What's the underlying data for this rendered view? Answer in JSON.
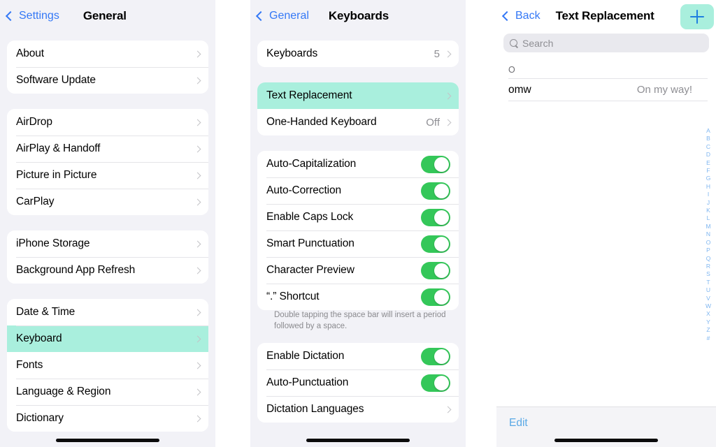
{
  "left_panel": {
    "nav": {
      "back_label": "Settings",
      "title": "General"
    },
    "groups": [
      {
        "rows": [
          {
            "label": "About",
            "accessory": "chevron"
          },
          {
            "label": "Software Update",
            "accessory": "chevron"
          }
        ]
      },
      {
        "rows": [
          {
            "label": "AirDrop",
            "accessory": "chevron"
          },
          {
            "label": "AirPlay & Handoff",
            "accessory": "chevron"
          },
          {
            "label": "Picture in Picture",
            "accessory": "chevron"
          },
          {
            "label": "CarPlay",
            "accessory": "chevron"
          }
        ]
      },
      {
        "rows": [
          {
            "label": "iPhone Storage",
            "accessory": "chevron"
          },
          {
            "label": "Background App Refresh",
            "accessory": "chevron"
          }
        ]
      },
      {
        "rows": [
          {
            "label": "Date & Time",
            "accessory": "chevron"
          },
          {
            "label": "Keyboard",
            "accessory": "chevron",
            "selected": true
          },
          {
            "label": "Fonts",
            "accessory": "chevron"
          },
          {
            "label": "Language & Region",
            "accessory": "chevron"
          },
          {
            "label": "Dictionary",
            "accessory": "chevron"
          }
        ]
      }
    ]
  },
  "mid_panel": {
    "nav": {
      "back_label": "General",
      "title": "Keyboards"
    },
    "group1": [
      {
        "label": "Keyboards",
        "value": "5",
        "accessory": "chevron"
      }
    ],
    "group2": [
      {
        "label": "Text Replacement",
        "accessory": "chevron",
        "selected": true
      },
      {
        "label": "One-Handed Keyboard",
        "value": "Off",
        "accessory": "chevron"
      }
    ],
    "group3": [
      {
        "label": "Auto-Capitalization",
        "toggle": "on"
      },
      {
        "label": "Auto-Correction",
        "toggle": "on"
      },
      {
        "label": "Enable Caps Lock",
        "toggle": "on"
      },
      {
        "label": "Smart Punctuation",
        "toggle": "on"
      },
      {
        "label": "Character Preview",
        "toggle": "on"
      },
      {
        "label": "“.” Shortcut",
        "toggle": "on"
      }
    ],
    "footnote": "Double tapping the space bar will insert a period followed by a space.",
    "group4": [
      {
        "label": "Enable Dictation",
        "toggle": "on"
      },
      {
        "label": "Auto-Punctuation",
        "toggle": "on"
      },
      {
        "label": "Dictation Languages",
        "accessory": "chevron"
      }
    ]
  },
  "right_panel": {
    "nav": {
      "back_label": "Back",
      "title": "Text Replacement",
      "add_icon": "plus-icon"
    },
    "search": {
      "placeholder": "Search",
      "value": "",
      "icon": "search-icon"
    },
    "sections": [
      {
        "header": "O",
        "items": [
          {
            "shortcut": "omw",
            "phrase": "On my way!"
          }
        ]
      }
    ],
    "index_letters": [
      "A",
      "B",
      "C",
      "D",
      "E",
      "F",
      "G",
      "H",
      "I",
      "J",
      "K",
      "L",
      "M",
      "N",
      "O",
      "P",
      "Q",
      "R",
      "S",
      "T",
      "U",
      "V",
      "W",
      "X",
      "Y",
      "Z",
      "#"
    ],
    "edit_label": "Edit"
  },
  "colors": {
    "selection_mint": "#a9efdd",
    "toggle_green": "#34c759",
    "link_blue": "#3478f6",
    "edit_blue": "#5aa9e6",
    "panel_bg": "#f2f2f7",
    "index_blue": "#7fb6f0"
  }
}
